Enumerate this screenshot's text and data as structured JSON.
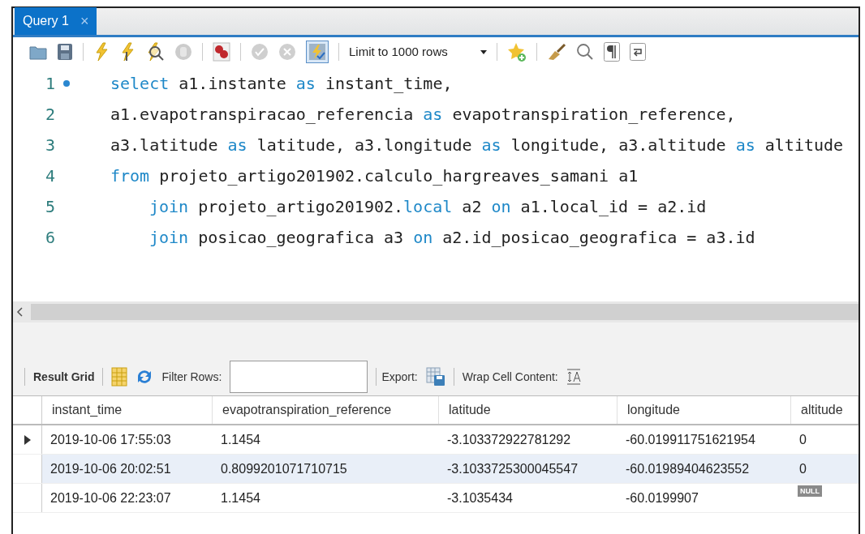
{
  "tabs": [
    {
      "label": "Query 1",
      "close": "×",
      "selected": true
    }
  ],
  "toolbar": {
    "limit": "Limit to 1000 rows",
    "commit_enabled": false,
    "autocommit_on": true
  },
  "editor": {
    "lines": [
      {
        "number": "1",
        "marker": true,
        "tokens": [
          {
            "kind": "keyword",
            "text": "select"
          },
          {
            "kind": "plain",
            "text": " a1.instante "
          },
          {
            "kind": "keyword",
            "text": "as"
          },
          {
            "kind": "plain",
            "text": " instant_time,"
          }
        ]
      },
      {
        "number": "2",
        "marker": false,
        "tokens": [
          {
            "kind": "plain",
            "text": "a1.evapotranspiracao_referencia "
          },
          {
            "kind": "keyword",
            "text": "as"
          },
          {
            "kind": "plain",
            "text": " evapotranspiration_reference,"
          }
        ]
      },
      {
        "number": "3",
        "marker": false,
        "tokens": [
          {
            "kind": "plain",
            "text": "a3.latitude "
          },
          {
            "kind": "keyword",
            "text": "as"
          },
          {
            "kind": "plain",
            "text": " latitude, a3.longitude "
          },
          {
            "kind": "keyword",
            "text": "as"
          },
          {
            "kind": "plain",
            "text": " longitude, a3.altitude "
          },
          {
            "kind": "keyword",
            "text": "as"
          },
          {
            "kind": "plain",
            "text": " altitude"
          }
        ]
      },
      {
        "number": "4",
        "marker": false,
        "tokens": [
          {
            "kind": "keyword",
            "text": "from"
          },
          {
            "kind": "plain",
            "text": " projeto_artigo201902.calculo_hargreaves_samani a1"
          }
        ],
        "children": [
          {
            "number": "5",
            "marker": false,
            "tokens": [
              {
                "kind": "keyword",
                "text": "join"
              },
              {
                "kind": "plain",
                "text": " projeto_artigo201902."
              },
              {
                "kind": "keyword",
                "text": "local"
              },
              {
                "kind": "plain",
                "text": " a2 "
              },
              {
                "kind": "keyword",
                "text": "on"
              },
              {
                "kind": "plain",
                "text": " a1.local_id = a2.id"
              }
            ]
          },
          {
            "number": "6",
            "marker": false,
            "tokens": [
              {
                "kind": "keyword",
                "text": "join"
              },
              {
                "kind": "plain",
                "text": " posicao_geografica a3 "
              },
              {
                "kind": "keyword",
                "text": "on"
              },
              {
                "kind": "plain",
                "text": " a2.id_posicao_geografica = a3.id"
              }
            ]
          }
        ]
      }
    ]
  },
  "results": {
    "title": "Result Grid",
    "filter_label": "Filter Rows:",
    "export_label": "Export:",
    "wrap_label": "Wrap Cell Content:",
    "columns": [
      "instant_time",
      "evapotranspiration_reference",
      "latitude",
      "longitude",
      "altitude"
    ],
    "rows": [
      {
        "current": true,
        "shaded": false,
        "cells": [
          "2019-10-06 17:55:03",
          "1.1454",
          "-3.103372922781292",
          "-60.019911751621954",
          "0"
        ]
      },
      {
        "current": false,
        "shaded": true,
        "cells": [
          "2019-10-06 20:02:51",
          "0.8099201071710715",
          "-3.1033725300045547",
          "-60.01989404623552",
          "0"
        ]
      },
      {
        "current": false,
        "shaded": false,
        "cells": [
          "2019-10-06 22:23:07",
          "1.1454",
          "-3.1035434",
          "-60.0199907",
          null
        ]
      }
    ],
    "null_badge": "NULL"
  }
}
